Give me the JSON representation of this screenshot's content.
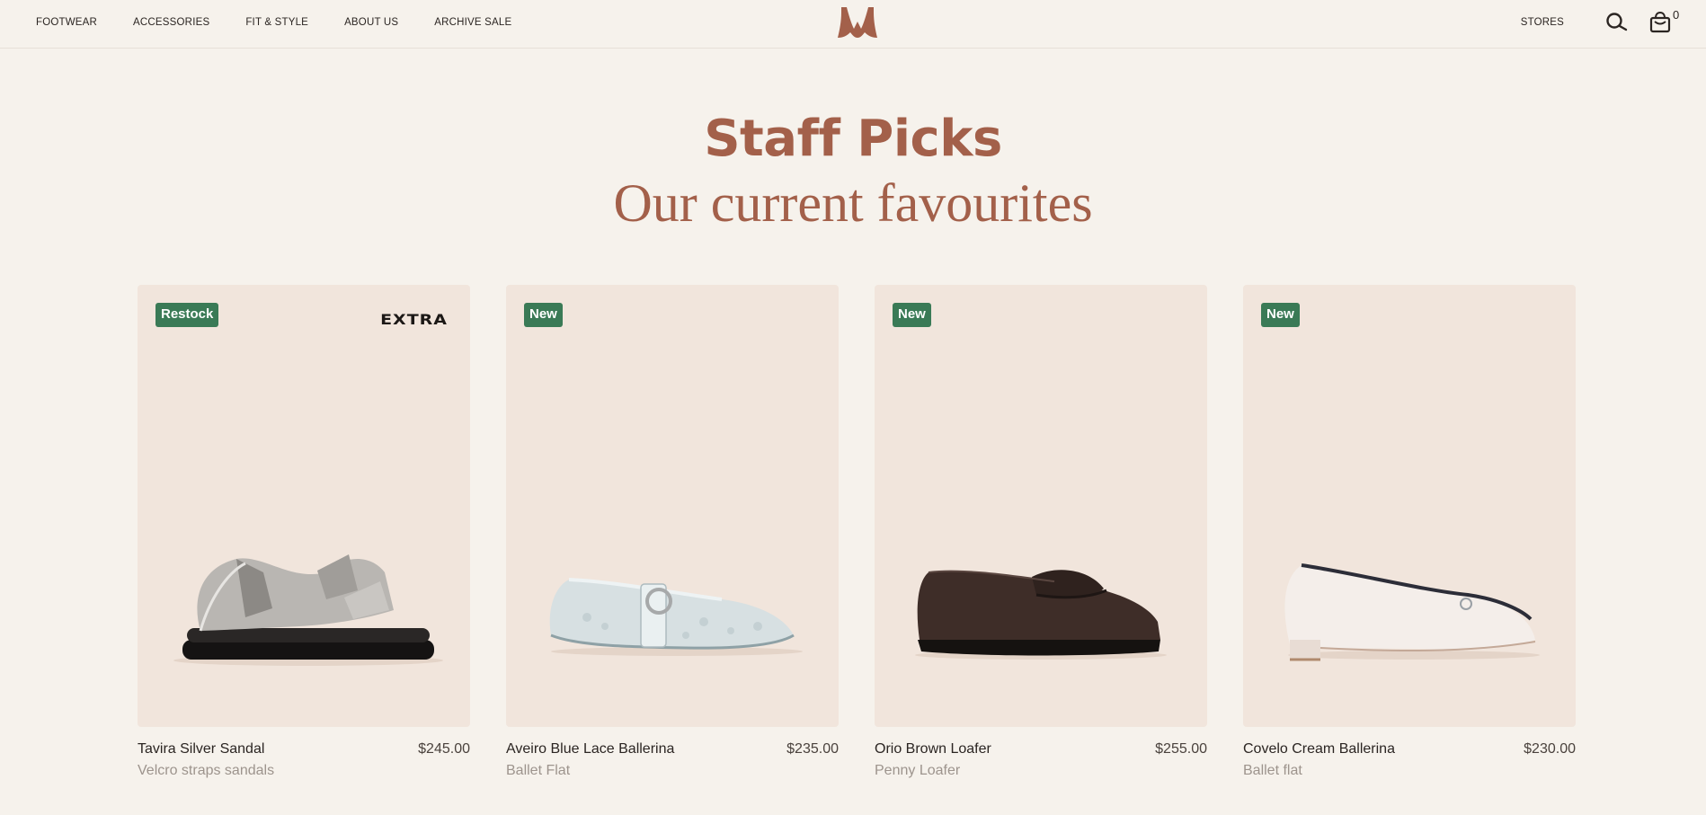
{
  "nav": {
    "left": [
      "FOOTWEAR",
      "ACCESSORIES",
      "FIT & STYLE",
      "ABOUT US",
      "ARCHIVE SALE"
    ],
    "stores": "STORES",
    "cart_count": "0",
    "icons": [
      "logo",
      "search-icon",
      "shopping-bag-icon"
    ]
  },
  "heading": {
    "title": "Staff Picks",
    "subtitle": "Our current favourites"
  },
  "colors": {
    "accent": "#a3604a",
    "badge": "#3a7a56",
    "card_bg": "#f1e5dc",
    "page_bg": "#f6f2ec"
  },
  "products": [
    {
      "badge": "Restock",
      "brand_mark": "EXTRA",
      "name": "Tavira Silver Sandal",
      "price": "$245.00",
      "subtitle": "Velcro straps sandals"
    },
    {
      "badge": "New",
      "name": "Aveiro Blue Lace Ballerina",
      "price": "$235.00",
      "subtitle": "Ballet Flat"
    },
    {
      "badge": "New",
      "name": "Orio Brown Loafer",
      "price": "$255.00",
      "subtitle": "Penny Loafer"
    },
    {
      "badge": "New",
      "name": "Covelo Cream Ballerina",
      "price": "$230.00",
      "subtitle": "Ballet flat"
    }
  ]
}
